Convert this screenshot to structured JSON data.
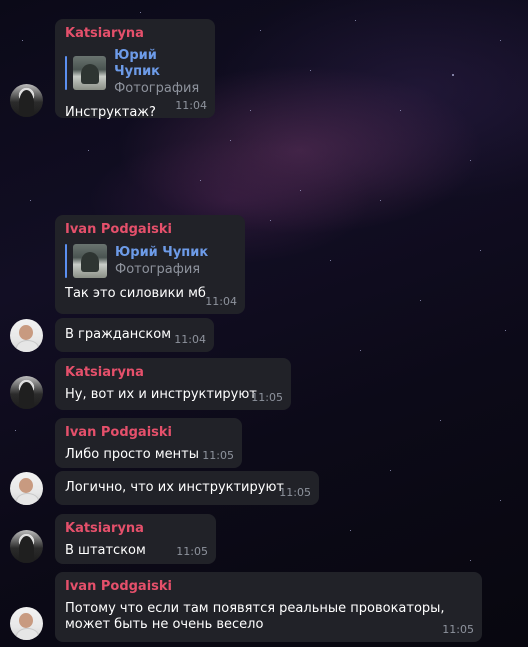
{
  "messages": [
    {
      "sender": "Katsiaryna",
      "reply": {
        "name": "Юрий Чупик",
        "subtitle": "Фотография"
      },
      "text": "Инструктаж?",
      "time": "11:04"
    },
    {
      "sender": "Ivan Podgaiski",
      "reply": {
        "name": "Юрий Чупик",
        "subtitle": "Фотография"
      },
      "text": "Так это силовики мб",
      "time": "11:04"
    },
    {
      "text": "В гражданском",
      "time": "11:04"
    },
    {
      "sender": "Katsiaryna",
      "text": "Ну, вот их и инструктируют",
      "time": "11:05"
    },
    {
      "sender": "Ivan Podgaiski",
      "text": "Либо просто менты",
      "time": "11:05"
    },
    {
      "text": "Логично, что их инструктируют",
      "time": "11:05"
    },
    {
      "sender": "Katsiaryna",
      "text": "В штатском",
      "time": "11:05"
    },
    {
      "sender": "Ivan Podgaiski",
      "text": "Потому что если там появятся реальные провокаторы, может быть не очень весело",
      "time": "11:05"
    }
  ],
  "colors": {
    "bubble": "#212228",
    "sender_name": "#e5506b",
    "reply_name": "#6d9be8",
    "reply_bar": "#5b8ff0",
    "time": "#8e939d"
  }
}
